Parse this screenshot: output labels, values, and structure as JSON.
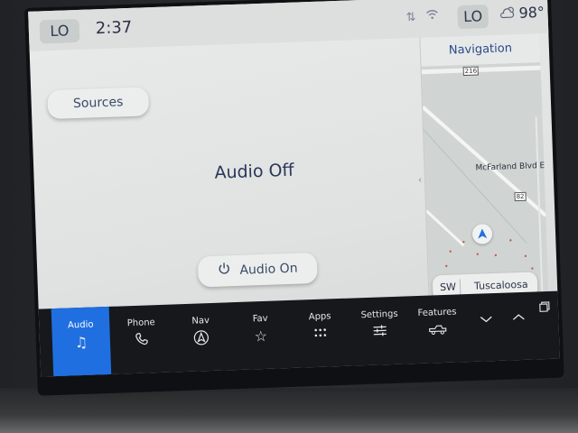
{
  "status": {
    "left_climate": "LO",
    "time": "2:37",
    "right_climate": "LO",
    "weather_icon": "cloud-sun-icon",
    "temperature": "98°"
  },
  "main": {
    "sources_label": "Sources",
    "audio_status": "Audio Off",
    "audio_on_label": "Audio On"
  },
  "navigation": {
    "title": "Navigation",
    "route_shield_1": "216",
    "route_shield_2": "82",
    "street_label": "McFarland Blvd E",
    "heading": "SW",
    "city": "Tuscaloosa"
  },
  "dock": {
    "items": [
      {
        "label": "Audio",
        "icon": "music-note-icon"
      },
      {
        "label": "Phone",
        "icon": "phone-icon"
      },
      {
        "label": "Nav",
        "icon": "nav-arrow-icon"
      },
      {
        "label": "Fav",
        "icon": "star-icon"
      },
      {
        "label": "Apps",
        "icon": "apps-grid-icon"
      },
      {
        "label": "Settings",
        "icon": "sliders-icon"
      },
      {
        "label": "Features",
        "icon": "truck-icon"
      }
    ]
  },
  "colors": {
    "accent": "#1f6fe0",
    "dock_bg": "#16181c",
    "screen_bg": "#e3e6e5"
  }
}
